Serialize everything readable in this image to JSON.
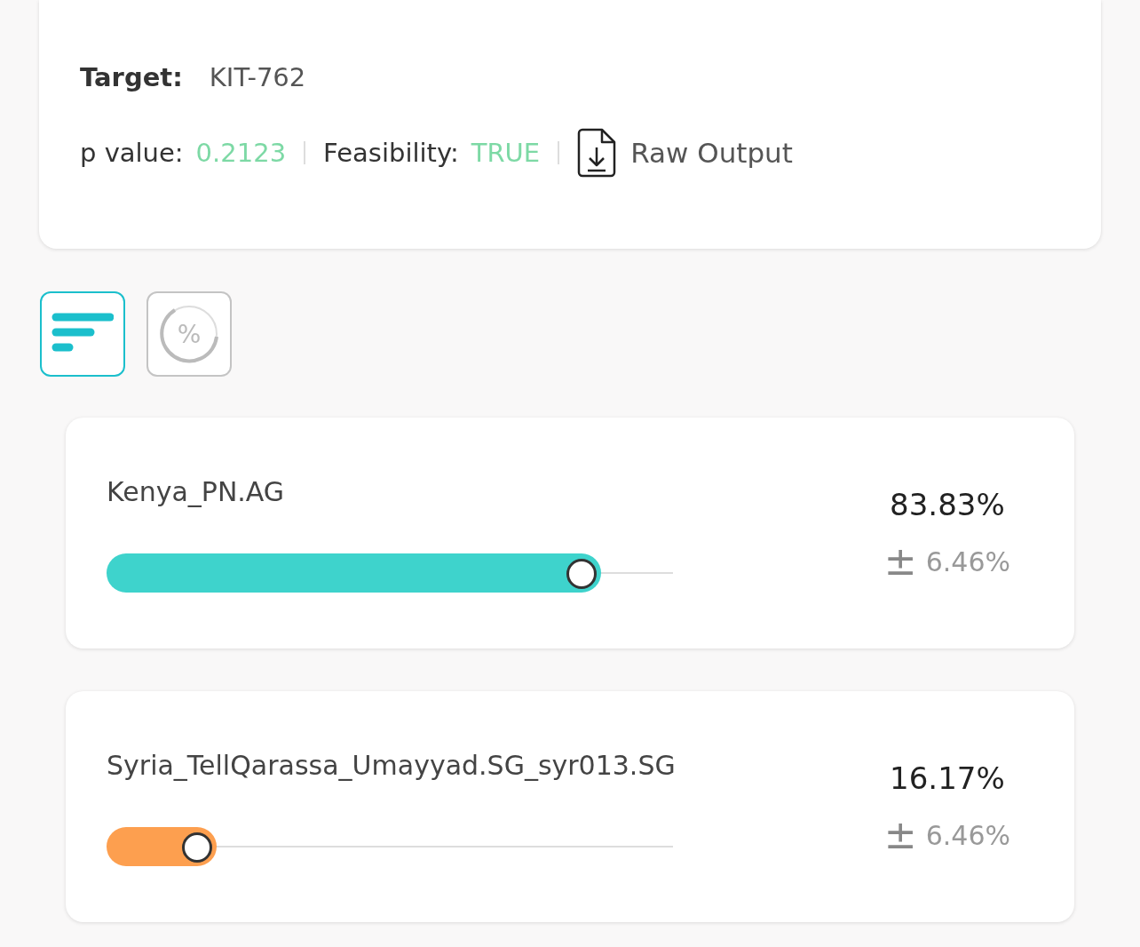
{
  "summary": {
    "target_label": "Target:",
    "target_value": "KIT-762",
    "p_label": "p value:",
    "p_value": "0.2123",
    "feasibility_label": "Feasibility:",
    "feasibility_value": "TRUE",
    "raw_output": "Raw Output"
  },
  "view_buttons": [
    {
      "kind": "bars",
      "selected": true
    },
    {
      "kind": "percent",
      "label": "%",
      "selected": false
    }
  ],
  "results": [
    {
      "name": "Kenya_PN.AG",
      "percent": "83.83%",
      "pm": "±",
      "error": "6.46%",
      "level": 0.838,
      "color": "#3ed3cc"
    },
    {
      "name": "Syria_TellQarassa_Umayyad.SG_syr013.SG",
      "percent": "16.17%",
      "pm": "±",
      "error": "6.46%",
      "level": 0.16,
      "color": "#fd9f4f"
    }
  ]
}
